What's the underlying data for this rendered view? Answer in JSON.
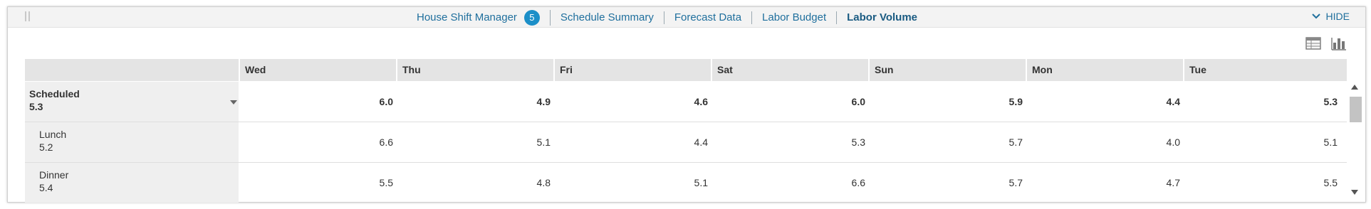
{
  "tabs": [
    {
      "label": "House Shift Manager",
      "badge": "5"
    },
    {
      "label": "Schedule Summary"
    },
    {
      "label": "Forecast Data"
    },
    {
      "label": "Labor Budget"
    },
    {
      "label": "Labor Volume",
      "active": true
    }
  ],
  "hide_label": "HIDE",
  "icons": {
    "grip": "drag-handle-icon",
    "hide": "chevron-down-icon",
    "table_view": "table-view-icon",
    "chart_view": "bar-chart-icon",
    "row_toggle": "caret-down-icon",
    "scroll_up": "scroll-up-arrow-icon",
    "scroll_down": "scroll-down-arrow-icon"
  },
  "colors": {
    "accent": "#1f6f9d",
    "badge": "#1c8fc8"
  },
  "table": {
    "header_blank": "",
    "days": [
      "Wed",
      "Thu",
      "Fri",
      "Sat",
      "Sun",
      "Mon",
      "Tue"
    ],
    "rows": [
      {
        "label": "Scheduled",
        "total": "5.3",
        "values": [
          "6.0",
          "4.9",
          "4.6",
          "6.0",
          "5.9",
          "4.4",
          "5.3"
        ]
      },
      {
        "label": "Lunch",
        "total": "5.2",
        "values": [
          "6.6",
          "5.1",
          "4.4",
          "5.3",
          "5.7",
          "4.0",
          "5.1"
        ]
      },
      {
        "label": "Dinner",
        "total": "5.4",
        "values": [
          "5.5",
          "4.8",
          "5.1",
          "6.6",
          "5.7",
          "4.7",
          "5.5"
        ]
      }
    ]
  }
}
